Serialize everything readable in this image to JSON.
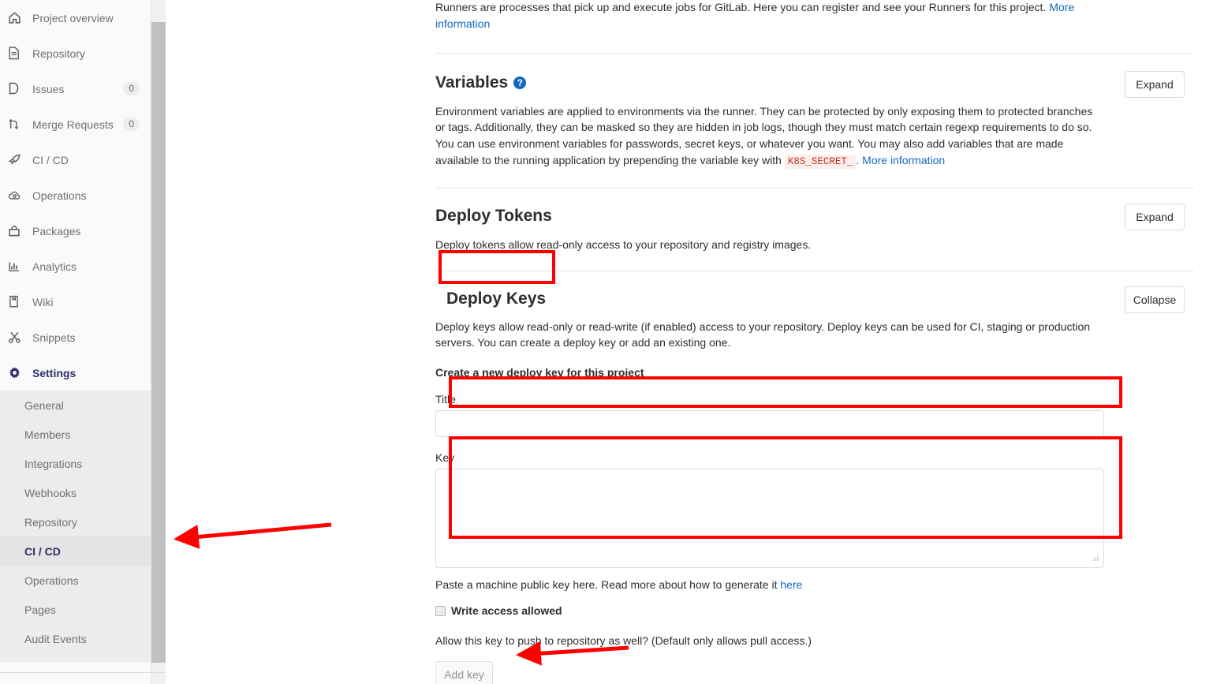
{
  "sidebar": {
    "top_items": [
      {
        "label": "Project overview",
        "icon": "home-icon",
        "badge": null
      },
      {
        "label": "Repository",
        "icon": "file-document-icon",
        "badge": null
      },
      {
        "label": "Issues",
        "icon": "issues-icon",
        "badge": "0"
      },
      {
        "label": "Merge Requests",
        "icon": "merge-request-icon",
        "badge": "0"
      },
      {
        "label": "CI / CD",
        "icon": "rocket-icon",
        "badge": null
      },
      {
        "label": "Operations",
        "icon": "cloud-gear-icon",
        "badge": null
      },
      {
        "label": "Packages",
        "icon": "package-icon",
        "badge": null
      },
      {
        "label": "Analytics",
        "icon": "bar-chart-icon",
        "badge": null
      },
      {
        "label": "Wiki",
        "icon": "book-icon",
        "badge": null
      },
      {
        "label": "Snippets",
        "icon": "scissors-icon",
        "badge": null
      },
      {
        "label": "Settings",
        "icon": "gear-icon",
        "badge": null
      }
    ],
    "settings_label": "Settings",
    "sub_items": [
      {
        "label": "General",
        "active": false
      },
      {
        "label": "Members",
        "active": false
      },
      {
        "label": "Integrations",
        "active": false
      },
      {
        "label": "Webhooks",
        "active": false
      },
      {
        "label": "Repository",
        "active": false
      },
      {
        "label": "CI / CD",
        "active": true
      },
      {
        "label": "Operations",
        "active": false
      },
      {
        "label": "Pages",
        "active": false
      },
      {
        "label": "Audit Events",
        "active": false
      }
    ]
  },
  "runners": {
    "description_part1": "Runners are processes that pick up and execute jobs for GitLab. Here you can register and see your Runners for this project. ",
    "more_info_link": "More information"
  },
  "variables": {
    "title": "Variables",
    "help_icon": "question-mark-icon",
    "expand_label": "Expand",
    "description_part1": "Environment variables are applied to environments via the runner. They can be protected by only exposing them to protected branches or tags. Additionally, they can be masked so they are hidden in job logs, though they must match certain regexp requirements to do so. You can use environment variables for passwords, secret keys, or whatever you want. You may also add variables that are made available to the running application by prepending the variable key with ",
    "code_token": "K8S_SECRET_",
    "description_part2": ". ",
    "more_info_link": "More information"
  },
  "deploy_tokens": {
    "title": "Deploy Tokens",
    "expand_label": "Expand",
    "description": "Deploy tokens allow read-only access to your repository and registry images."
  },
  "deploy_keys": {
    "title": "Deploy Keys",
    "collapse_label": "Collapse",
    "description": "Deploy keys allow read-only or read-write (if enabled) access to your repository. Deploy keys can be used for CI, staging or production servers. You can create a deploy key or add an existing one.",
    "form_heading": "Create a new deploy key for this project",
    "title_label": "Title",
    "title_value": "",
    "title_placeholder": "",
    "key_label": "Key",
    "key_value": "",
    "key_placeholder": "",
    "key_hint_text": "Paste a machine public key here. Read more about how to generate it ",
    "key_hint_link": "here",
    "write_access_label": "Write access allowed",
    "write_access_checked": false,
    "write_access_help": "Allow this key to push to repository as well? (Default only allows pull access.)",
    "add_key_label": "Add key"
  },
  "annotations": {
    "highlight_color": "#ff0000",
    "boxes": [
      "deploy-keys-title",
      "title-input",
      "key-textarea"
    ],
    "arrows": [
      "arrow-to-cicd-sidebar",
      "arrow-to-add-key-button"
    ]
  }
}
